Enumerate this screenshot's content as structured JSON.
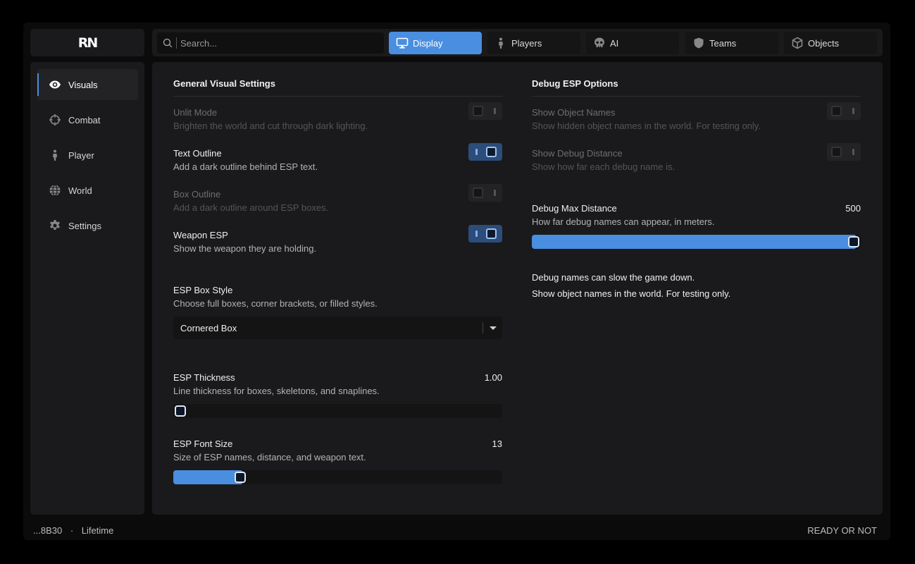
{
  "app": {
    "logo": "RN"
  },
  "search": {
    "placeholder": "Search..."
  },
  "tabs": [
    {
      "label": "Display",
      "icon": "monitor-icon",
      "active": true
    },
    {
      "label": "Players",
      "icon": "person-icon"
    },
    {
      "label": "AI",
      "icon": "skull-icon"
    },
    {
      "label": "Teams",
      "icon": "shield-icon"
    },
    {
      "label": "Objects",
      "icon": "cube-icon"
    }
  ],
  "sidebar": {
    "items": [
      {
        "label": "Visuals",
        "icon": "eye-icon",
        "active": true
      },
      {
        "label": "Combat",
        "icon": "crosshair-icon"
      },
      {
        "label": "Player",
        "icon": "person-icon"
      },
      {
        "label": "World",
        "icon": "globe-icon"
      },
      {
        "label": "Settings",
        "icon": "gear-icon"
      }
    ]
  },
  "general": {
    "title": "General Visual Settings",
    "options": [
      {
        "title": "Unlit Mode",
        "desc": "Brighten the world and cut through dark lighting.",
        "on": false
      },
      {
        "title": "Text Outline",
        "desc": "Add a dark outline behind ESP text.",
        "on": true
      },
      {
        "title": "Box Outline",
        "desc": "Add a dark outline around ESP boxes.",
        "on": false
      },
      {
        "title": "Weapon ESP",
        "desc": "Show the weapon they are holding.",
        "on": true
      }
    ],
    "box_style": {
      "title": "ESP Box Style",
      "desc": "Choose full boxes, corner brackets, or filled styles.",
      "selected": "Cornered Box"
    },
    "thickness": {
      "title": "ESP Thickness",
      "desc": "Line thickness for boxes, skeletons, and snaplines.",
      "value": "1.00",
      "fraction": 0.0
    },
    "font_size": {
      "title": "ESP Font Size",
      "desc": "Size of ESP names, distance, and weapon text.",
      "value": "13",
      "fraction": 0.19
    }
  },
  "debug": {
    "title": "Debug ESP Options",
    "options": [
      {
        "title": "Show Object Names",
        "desc": "Show hidden object names in the world. For testing only.",
        "on": false
      },
      {
        "title": "Show Debug Distance",
        "desc": "Show how far each debug name is.",
        "on": false
      }
    ],
    "max_distance": {
      "title": "Debug Max Distance",
      "desc": "How far debug names can appear, in meters.",
      "value": "500",
      "fraction": 1.0
    },
    "notes": [
      "Debug names can slow the game down.",
      "Show object names in the world. For testing only."
    ]
  },
  "status": {
    "id": "...8B30",
    "separator": "·",
    "plan": "Lifetime",
    "game": "READY OR NOT"
  },
  "colors": {
    "accent": "#4a8ee0",
    "panel": "#1a1a1c",
    "background": "#0b0b0c"
  }
}
